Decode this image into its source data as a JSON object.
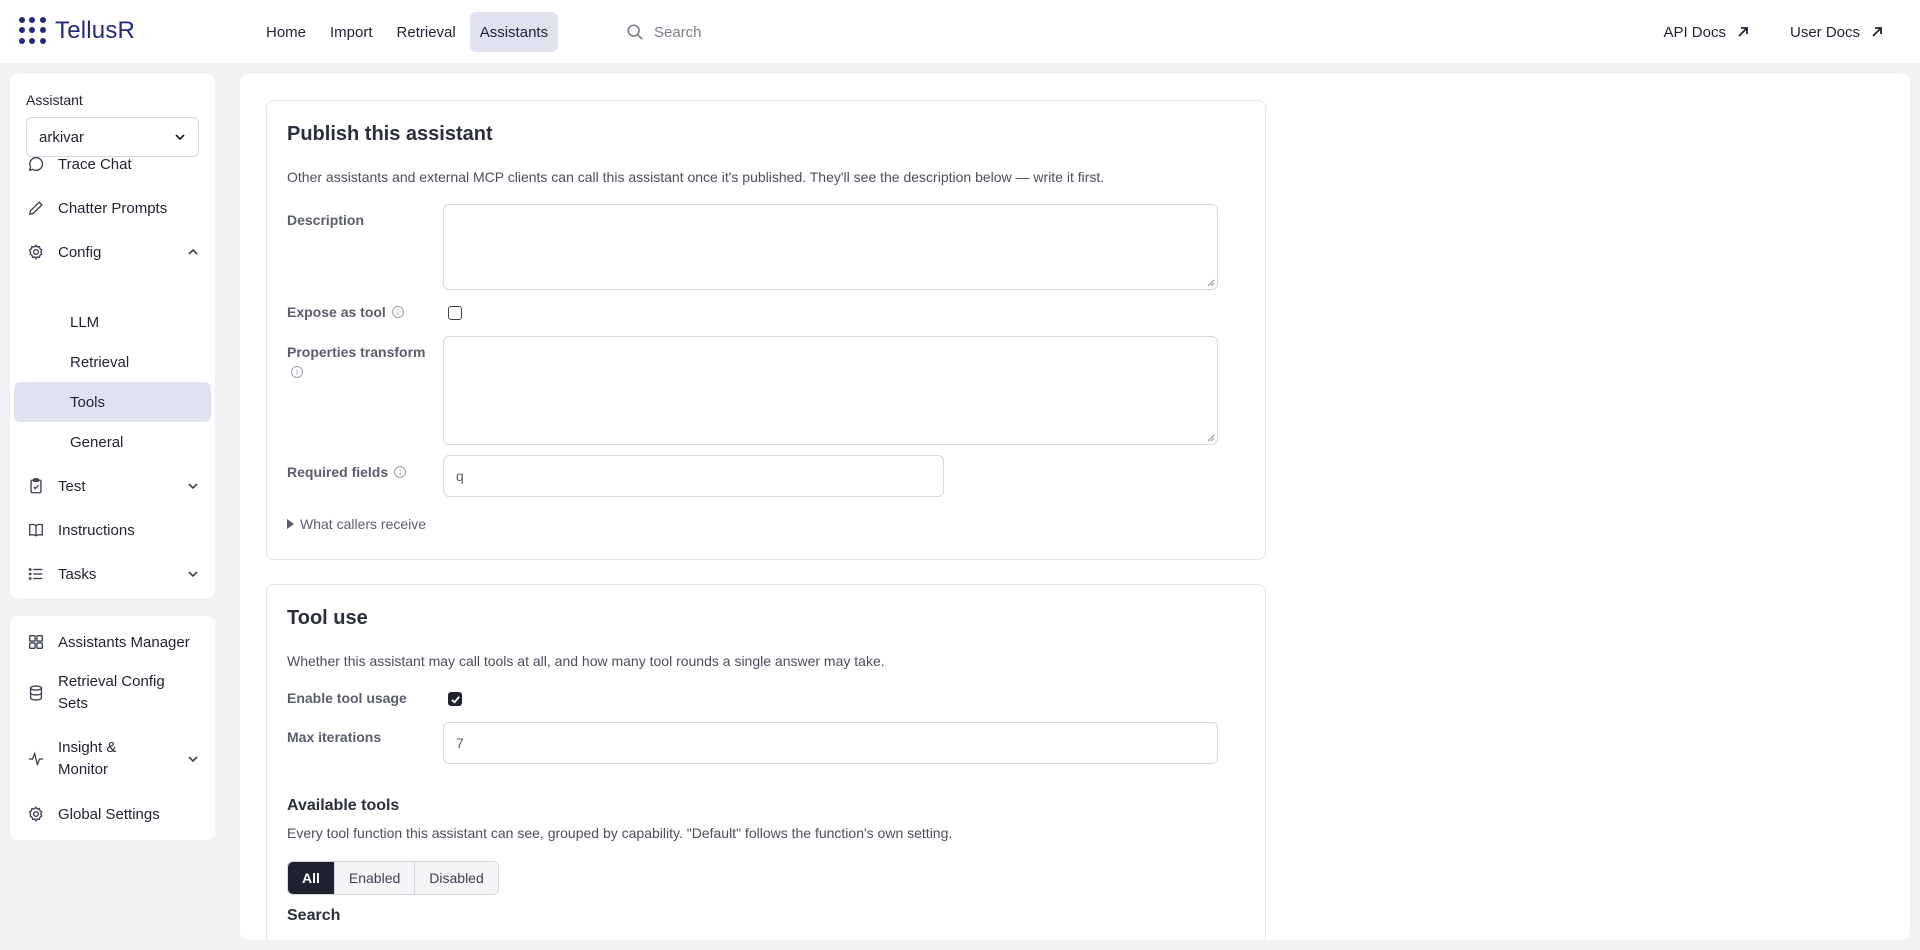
{
  "app": {
    "name": "TellusR"
  },
  "nav": {
    "items": [
      {
        "label": "Home"
      },
      {
        "label": "Import"
      },
      {
        "label": "Retrieval"
      },
      {
        "label": "Assistants",
        "active": true
      }
    ],
    "search_placeholder": "Search",
    "links": [
      {
        "label": "API Docs"
      },
      {
        "label": "User Docs"
      }
    ]
  },
  "sidebar": {
    "assistant_label": "Assistant",
    "assistant_value": "arkivar",
    "items": [
      {
        "label": "Trace Chat",
        "icon": "chat-bubble-icon"
      },
      {
        "label": "Chatter Prompts",
        "icon": "pencil-icon"
      },
      {
        "label": "Config",
        "icon": "gear-icon",
        "expanded": true
      }
    ],
    "config_subitems": [
      {
        "label": "LLM"
      },
      {
        "label": "Retrieval"
      },
      {
        "label": "Tools",
        "active": true
      },
      {
        "label": "General"
      }
    ],
    "items_after": [
      {
        "label": "Test",
        "icon": "clipboard-check-icon"
      },
      {
        "label": "Instructions",
        "icon": "book-icon"
      },
      {
        "label": "Tasks",
        "icon": "list-icon"
      }
    ],
    "bottom_items": [
      {
        "label": "Assistants Manager",
        "icon": "grid-icon"
      },
      {
        "label": "Retrieval Config Sets",
        "icon": "database-icon"
      },
      {
        "label": "Insight & Monitor",
        "icon": "activity-icon"
      },
      {
        "label": "Global Settings",
        "icon": "gear-icon"
      }
    ]
  },
  "publish": {
    "title": "Publish this assistant",
    "description": "Other assistants and external MCP clients can call this assistant once it's published. They'll see the description below — write it first.",
    "description_label": "Description",
    "description_value": "",
    "expose_label": "Expose as tool",
    "expose_checked": false,
    "properties_label": "Properties transform",
    "properties_value": "",
    "required_label": "Required fields",
    "required_value": "q",
    "callers_label": "What callers receive"
  },
  "tool_use": {
    "title": "Tool use",
    "description": "Whether this assistant may call tools at all, and how many tool rounds a single answer may take.",
    "enable_label": "Enable tool usage",
    "enable_checked": true,
    "max_iter_label": "Max iterations",
    "max_iter_value": "7",
    "available_title": "Available tools",
    "available_desc": "Every tool function this assistant can see, grouped by capability. \"Default\" follows the function's own setting.",
    "filters": [
      {
        "label": "All",
        "active": true
      },
      {
        "label": "Enabled"
      },
      {
        "label": "Disabled"
      }
    ],
    "search_label": "Search"
  }
}
